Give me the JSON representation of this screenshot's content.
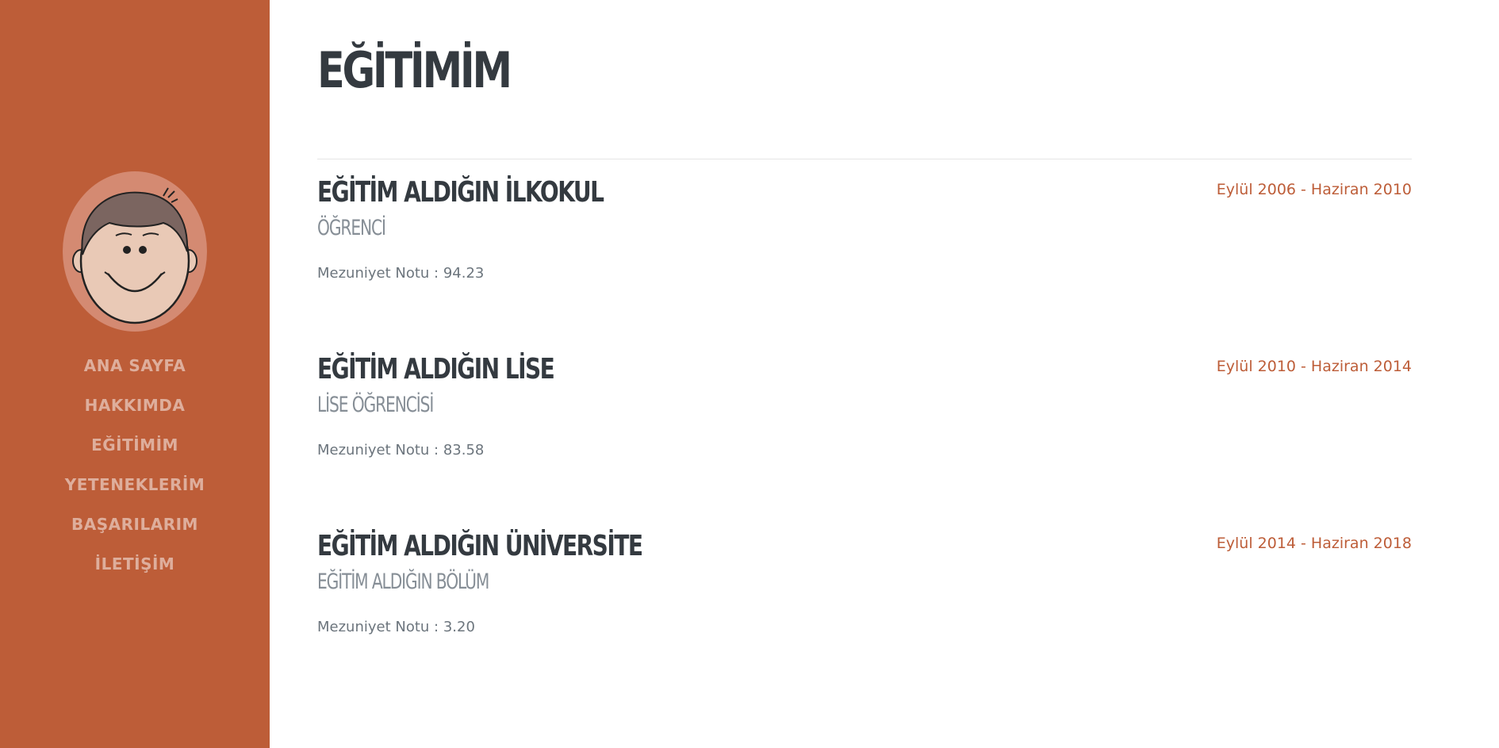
{
  "sidebar": {
    "avatar_alt": "Profile avatar",
    "nav": [
      {
        "label": "ANA SAYFA"
      },
      {
        "label": "HAKKIMDA"
      },
      {
        "label": "EĞİTİMİM"
      },
      {
        "label": "YETENEKLERİM"
      },
      {
        "label": "BAŞARILARIM"
      },
      {
        "label": "İLETİŞİM"
      }
    ]
  },
  "main": {
    "title": "EĞİTİMİM",
    "entries": [
      {
        "school": "EĞİTİM ALDIĞIN İLKOKUL",
        "role": "ÖĞRENCİ",
        "grade": "Mezuniyet Notu : 94.23",
        "date": "Eylül 2006 - Haziran 2010"
      },
      {
        "school": "EĞİTİM ALDIĞIN LİSE",
        "role": "LİSE ÖĞRENCİSİ",
        "grade": "Mezuniyet Notu : 83.58",
        "date": "Eylül 2010 - Haziran 2014"
      },
      {
        "school": "EĞİTİM ALDIĞIN ÜNİVERSİTE",
        "role": "EĞİTİM ALDIĞIN BÖLÜM",
        "grade": "Mezuniyet Notu : 3.20",
        "date": "Eylül 2014 - Haziran 2018"
      }
    ]
  },
  "colors": {
    "sidebar_bg": "#bd5d38",
    "accent": "#bd5d38",
    "heading": "#343a40",
    "muted": "#868e96"
  }
}
